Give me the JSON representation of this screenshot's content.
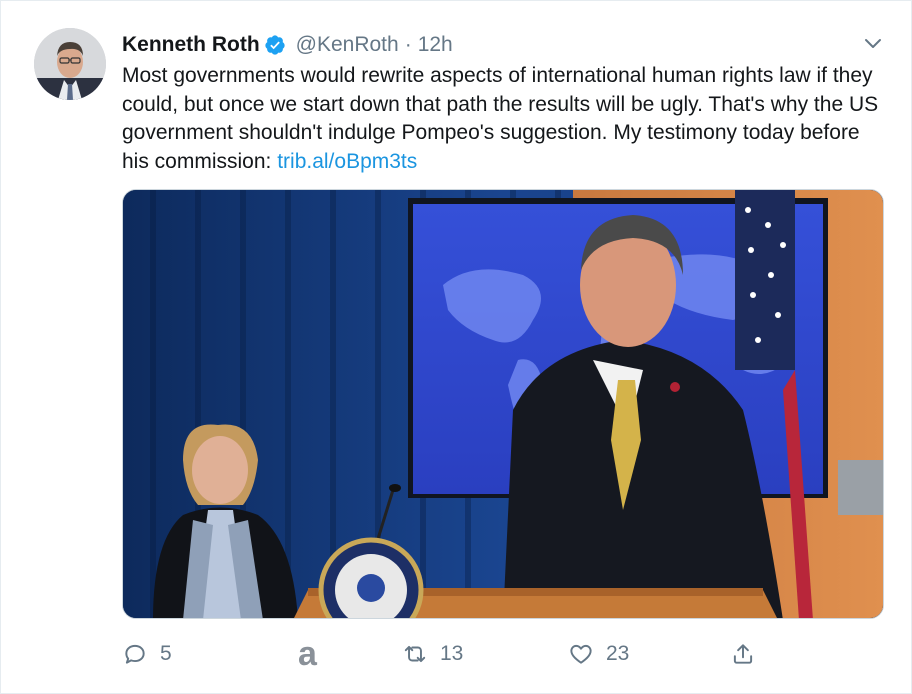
{
  "tweet": {
    "author_name": "Kenneth Roth",
    "handle": "@KenRoth",
    "separator": "·",
    "time": "12h",
    "text_main": "Most governments would rewrite aspects of international human rights law if they could, but once we start down that path the results will be ugly. That's why the US government shouldn't indulge Pompeo's suggestion. My testimony today before his commission: ",
    "link_text": "trib.al/oBpm3ts"
  },
  "actions": {
    "reply_count": "5",
    "extension_badge": "a",
    "retweet_count": "13",
    "like_count": "23"
  },
  "icons": {
    "verified": "verified-badge-icon",
    "menu": "chevron-down-icon",
    "reply": "reply-icon",
    "retweet": "retweet-icon",
    "like": "heart-icon",
    "share": "share-icon"
  },
  "colors": {
    "link": "#1b95e0",
    "verified": "#1da1f2",
    "muted": "#657786"
  }
}
